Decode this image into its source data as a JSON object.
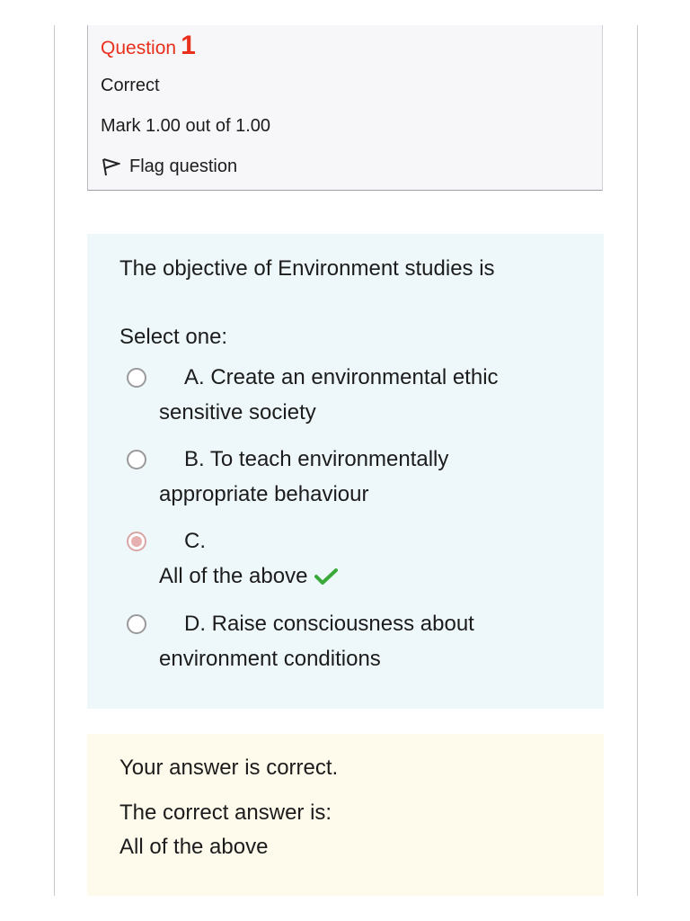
{
  "info": {
    "question_word": "Question",
    "question_number": "1",
    "state": "Correct",
    "grade": "Mark 1.00 out of 1.00",
    "flag_label": "Flag question",
    "flag_icon": "flag-icon"
  },
  "question": {
    "text": "The objective of Environment studies is",
    "prompt": "Select one:",
    "options": [
      {
        "line1": "A. Create an environmental ethic",
        "line2": "sensitive society",
        "selected": false
      },
      {
        "line1": "B. To teach environmentally",
        "line2": "appropriate behaviour",
        "selected": false
      },
      {
        "line1": "C.",
        "line2": "All of the above",
        "selected": true,
        "mark_icon": "check-icon"
      },
      {
        "line1": "D. Raise consciousness about",
        "line2": "environment conditions",
        "selected": false
      }
    ]
  },
  "feedback": {
    "result": "Your answer is correct.",
    "right_answer_label": "The correct answer is:",
    "right_answer": "All of the above"
  },
  "colors": {
    "question_label": "#e8301c",
    "content_bg": "#eef8fb",
    "feedback_bg": "#fffbec",
    "check": "#3aa93a"
  }
}
